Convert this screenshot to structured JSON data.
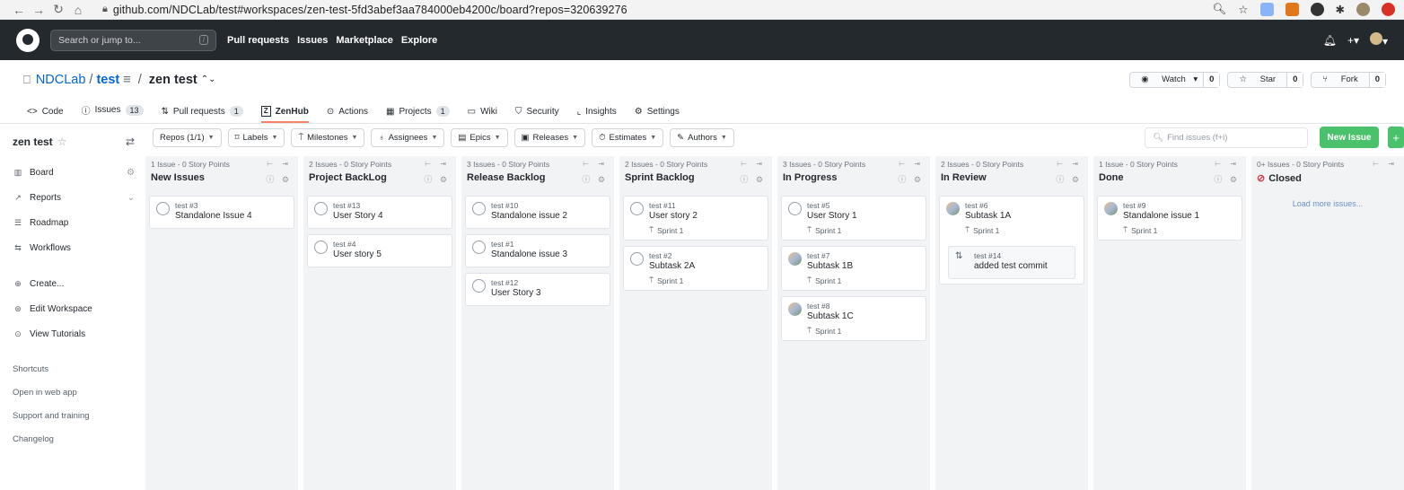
{
  "browser": {
    "url": "github.com/NDCLab/test#workspaces/zen-test-5fd3abef3aa784000eb4200c/board?repos=320639276"
  },
  "github": {
    "search_placeholder": "Search or jump to...",
    "search_shortcut": "/",
    "nav": [
      "Pull requests",
      "Issues",
      "Marketplace",
      "Explore"
    ]
  },
  "repo": {
    "owner": "NDCLab",
    "name": "test",
    "workspace": "zen test",
    "watch_label": "Watch",
    "watch_count": "0",
    "star_label": "Star",
    "star_count": "0",
    "fork_label": "Fork",
    "fork_count": "0"
  },
  "tabs": {
    "code": "Code",
    "issues": "Issues",
    "issues_count": "13",
    "pulls": "Pull requests",
    "pulls_count": "1",
    "zenhub": "ZenHub",
    "actions": "Actions",
    "projects": "Projects",
    "projects_count": "1",
    "wiki": "Wiki",
    "security": "Security",
    "insights": "Insights",
    "settings": "Settings"
  },
  "sidebar": {
    "workspace_title": "zen test",
    "items": [
      "Board",
      "Reports",
      "Roadmap",
      "Workflows"
    ],
    "actions": [
      "Create...",
      "Edit Workspace",
      "View Tutorials"
    ],
    "links": [
      "Shortcuts",
      "Open in web app",
      "Support and training",
      "Changelog"
    ]
  },
  "toolbar": {
    "filters": [
      "Repos (1/1)",
      "Labels",
      "Milestones",
      "Assignees",
      "Epics",
      "Releases",
      "Estimates",
      "Authors"
    ],
    "find_placeholder": "Find issues (f+i)",
    "new_issue": "New Issue",
    "plus": "+"
  },
  "columns": [
    {
      "meta": "1 Issue - 0 Story Points",
      "name": "New Issues",
      "cards": [
        {
          "ref": "test #3",
          "title": "Standalone Issue 4"
        }
      ]
    },
    {
      "meta": "2 Issues - 0 Story Points",
      "name": "Project BackLog",
      "cards": [
        {
          "ref": "test #13",
          "title": "User Story 4"
        },
        {
          "ref": "test #4",
          "title": "User story 5"
        }
      ]
    },
    {
      "meta": "3 Issues - 0 Story Points",
      "name": "Release Backlog",
      "cards": [
        {
          "ref": "test #10",
          "title": "Standalone issue 2"
        },
        {
          "ref": "test #1",
          "title": "Standalone issue 3"
        },
        {
          "ref": "test #12",
          "title": "User Story 3"
        }
      ]
    },
    {
      "meta": "2 Issues - 0 Story Points",
      "name": "Sprint Backlog",
      "cards": [
        {
          "ref": "test #11",
          "title": "User story 2",
          "sprint": "Sprint 1"
        },
        {
          "ref": "test #2",
          "title": "Subtask 2A",
          "sprint": "Sprint 1"
        }
      ]
    },
    {
      "meta": "3 Issues - 0 Story Points",
      "name": "In Progress",
      "cards": [
        {
          "ref": "test #5",
          "title": "User Story 1",
          "sprint": "Sprint 1"
        },
        {
          "ref": "test #7",
          "title": "Subtask 1B",
          "sprint": "Sprint 1"
        },
        {
          "ref": "test #8",
          "title": "Subtask 1C",
          "sprint": "Sprint 1"
        }
      ]
    },
    {
      "meta": "2 Issues - 0 Story Points",
      "name": "In Review",
      "cards": [
        {
          "ref": "test #6",
          "title": "Subtask 1A",
          "sprint": "Sprint 1"
        }
      ],
      "commit": {
        "ref": "test #14",
        "title": "added test commit"
      }
    },
    {
      "meta": "1 Issue - 0 Story Points",
      "name": "Done",
      "cards": [
        {
          "ref": "test #9",
          "title": "Standalone issue 1",
          "sprint": "Sprint 1"
        }
      ]
    },
    {
      "meta": "0+ Issues - 0 Story Points",
      "name": "Closed",
      "load_more": "Load more issues..."
    }
  ]
}
